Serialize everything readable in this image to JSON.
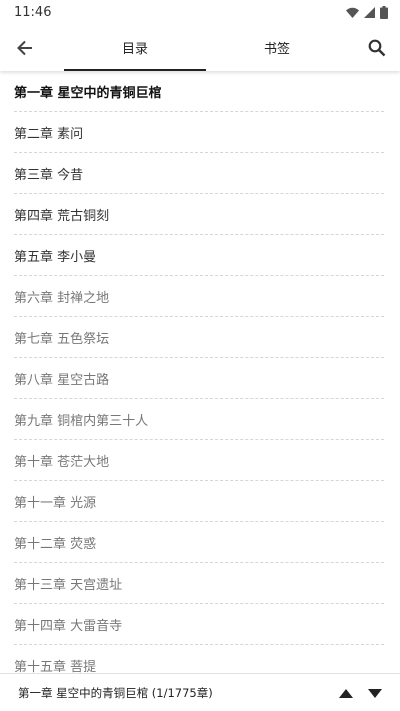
{
  "status_bar": {
    "time": "11:46",
    "icons": [
      "wifi-icon",
      "signal-icon",
      "battery-icon"
    ]
  },
  "toolbar": {
    "back_icon": "arrow-left-icon",
    "search_icon": "search-icon",
    "tabs": [
      {
        "label": "目录",
        "selected": true
      },
      {
        "label": "书签",
        "selected": false
      }
    ]
  },
  "chapters": [
    {
      "title": "第一章 星空中的青铜巨棺",
      "state": "current"
    },
    {
      "title": "第二章 素问",
      "state": "read"
    },
    {
      "title": "第三章 今昔",
      "state": "read"
    },
    {
      "title": "第四章 荒古铜刻",
      "state": "read"
    },
    {
      "title": "第五章 李小曼",
      "state": "read"
    },
    {
      "title": "第六章 封禅之地",
      "state": "unread"
    },
    {
      "title": "第七章 五色祭坛",
      "state": "unread"
    },
    {
      "title": "第八章 星空古路",
      "state": "unread"
    },
    {
      "title": "第九章 铜棺内第三十人",
      "state": "unread"
    },
    {
      "title": "第十章 苍茫大地",
      "state": "unread"
    },
    {
      "title": "第十一章 光源",
      "state": "unread"
    },
    {
      "title": "第十二章 荧惑",
      "state": "unread"
    },
    {
      "title": "第十三章 天宫遗址",
      "state": "unread"
    },
    {
      "title": "第十四章 大雷音寺",
      "state": "unread"
    },
    {
      "title": "第十五章 菩提",
      "state": "unread"
    }
  ],
  "bottom_bar": {
    "current_label": "第一章 星空中的青铜巨棺 (1/1775章)",
    "up_icon": "triangle-up-icon",
    "down_icon": "triangle-down-icon"
  }
}
